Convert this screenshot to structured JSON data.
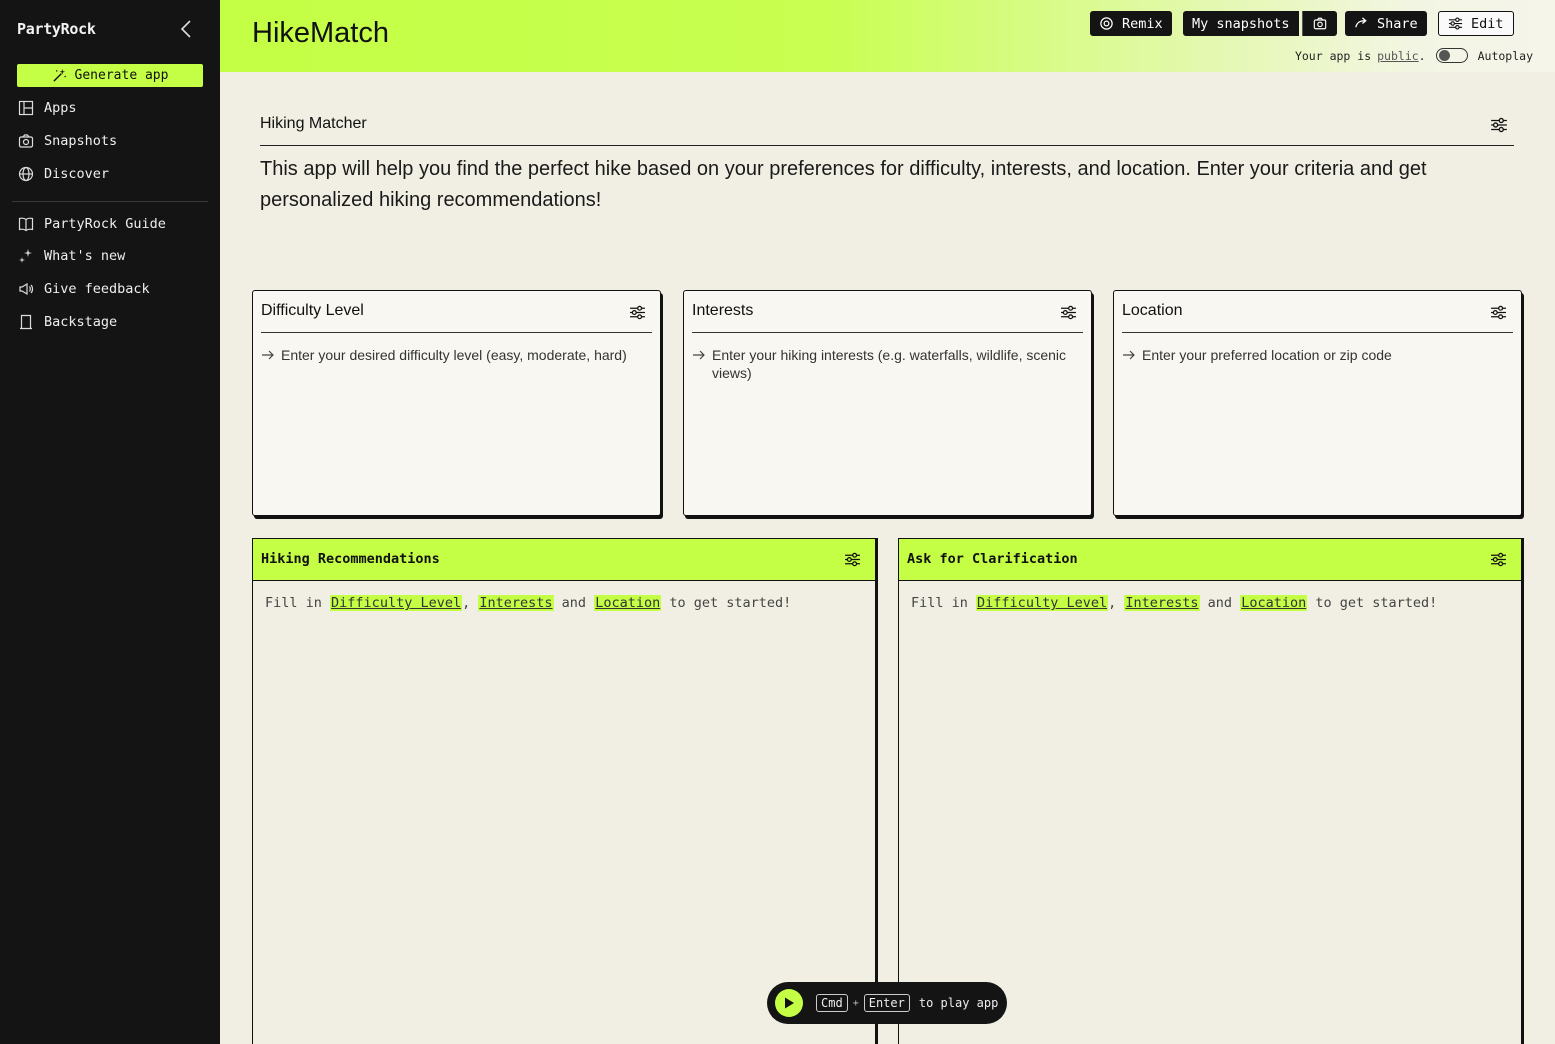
{
  "sidebar": {
    "brand": "PartyRock",
    "generate_label": "Generate app",
    "nav": [
      {
        "label": "Apps",
        "icon": "grid-icon"
      },
      {
        "label": "Snapshots",
        "icon": "camera-icon"
      },
      {
        "label": "Discover",
        "icon": "globe-icon"
      }
    ],
    "nav2": [
      {
        "label": "PartyRock Guide",
        "icon": "book-icon"
      },
      {
        "label": "What's new",
        "icon": "sparkle-icon"
      },
      {
        "label": "Give feedback",
        "icon": "megaphone-icon"
      },
      {
        "label": "Backstage",
        "icon": "bookmark-icon"
      }
    ]
  },
  "header": {
    "title": "HikeMatch",
    "remix_label": "Remix",
    "snapshots_label": "My snapshots",
    "share_label": "Share",
    "edit_label": "Edit",
    "public_prefix": "Your app is",
    "public_link": "public",
    "public_suffix": ".",
    "autoplay_label": "Autoplay"
  },
  "intro": {
    "title": "Hiking Matcher",
    "description": "This app will help you find the perfect hike based on your preferences for difficulty, interests, and location. Enter your criteria and get personalized hiking recommendations!"
  },
  "inputs": [
    {
      "title": "Difficulty Level",
      "placeholder": "Enter your desired difficulty level (easy, moderate, hard)"
    },
    {
      "title": "Interests",
      "placeholder": "Enter your hiking interests (e.g. waterfalls, wildlife, scenic views)"
    },
    {
      "title": "Location",
      "placeholder": "Enter your preferred location or zip code"
    }
  ],
  "outputs": [
    {
      "title": "Hiking Recommendations"
    },
    {
      "title": "Ask for Clarification"
    }
  ],
  "hint": {
    "fill_in": "Fill in",
    "field1": "Difficulty Level",
    "comma": ",",
    "field2": "Interests",
    "and": "and",
    "field3": "Location",
    "suffix": "to get started!"
  },
  "playbar": {
    "key1": "Cmd",
    "plus": "+",
    "key2": "Enter",
    "label": "to play app"
  },
  "colors": {
    "accent": "#c4ff45",
    "sidebar_bg": "#141414",
    "page_bg": "#f1efe3"
  }
}
